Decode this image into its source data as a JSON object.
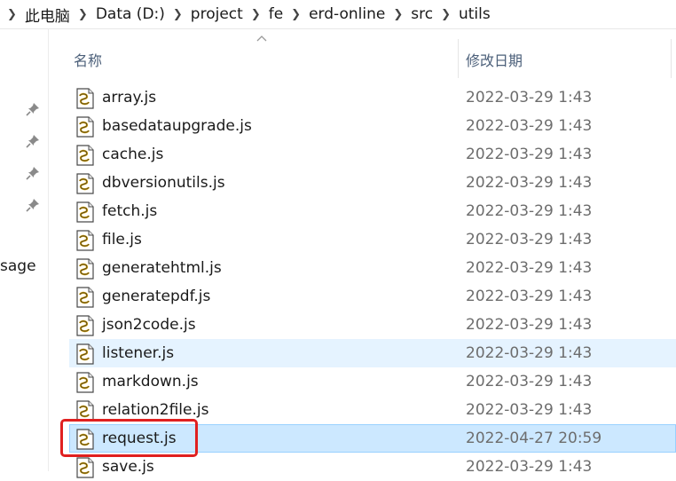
{
  "breadcrumb": [
    "此电脑",
    "Data (D:)",
    "project",
    "fe",
    "erd-online",
    "src",
    "utils"
  ],
  "nav": {
    "partial_label": "sage"
  },
  "columns": {
    "name": "名称",
    "date": "修改日期"
  },
  "files": [
    {
      "name": "array.js",
      "date": "2022-03-29 1:43",
      "state": "normal"
    },
    {
      "name": "basedataupgrade.js",
      "date": "2022-03-29 1:43",
      "state": "normal"
    },
    {
      "name": "cache.js",
      "date": "2022-03-29 1:43",
      "state": "normal"
    },
    {
      "name": "dbversionutils.js",
      "date": "2022-03-29 1:43",
      "state": "normal"
    },
    {
      "name": "fetch.js",
      "date": "2022-03-29 1:43",
      "state": "normal"
    },
    {
      "name": "file.js",
      "date": "2022-03-29 1:43",
      "state": "normal"
    },
    {
      "name": "generatehtml.js",
      "date": "2022-03-29 1:43",
      "state": "normal"
    },
    {
      "name": "generatepdf.js",
      "date": "2022-03-29 1:43",
      "state": "normal"
    },
    {
      "name": "json2code.js",
      "date": "2022-03-29 1:43",
      "state": "normal"
    },
    {
      "name": "listener.js",
      "date": "2022-03-29 1:43",
      "state": "hover"
    },
    {
      "name": "markdown.js",
      "date": "2022-03-29 1:43",
      "state": "normal"
    },
    {
      "name": "relation2file.js",
      "date": "2022-03-29 1:43",
      "state": "normal"
    },
    {
      "name": "request.js",
      "date": "2022-04-27 20:59",
      "state": "selected"
    },
    {
      "name": "save.js",
      "date": "2022-03-29 1:43",
      "state": "normal"
    }
  ],
  "colors": {
    "selected_bg": "#cce8ff",
    "hover_bg": "#e5f3ff",
    "annotation": "#e02020"
  }
}
